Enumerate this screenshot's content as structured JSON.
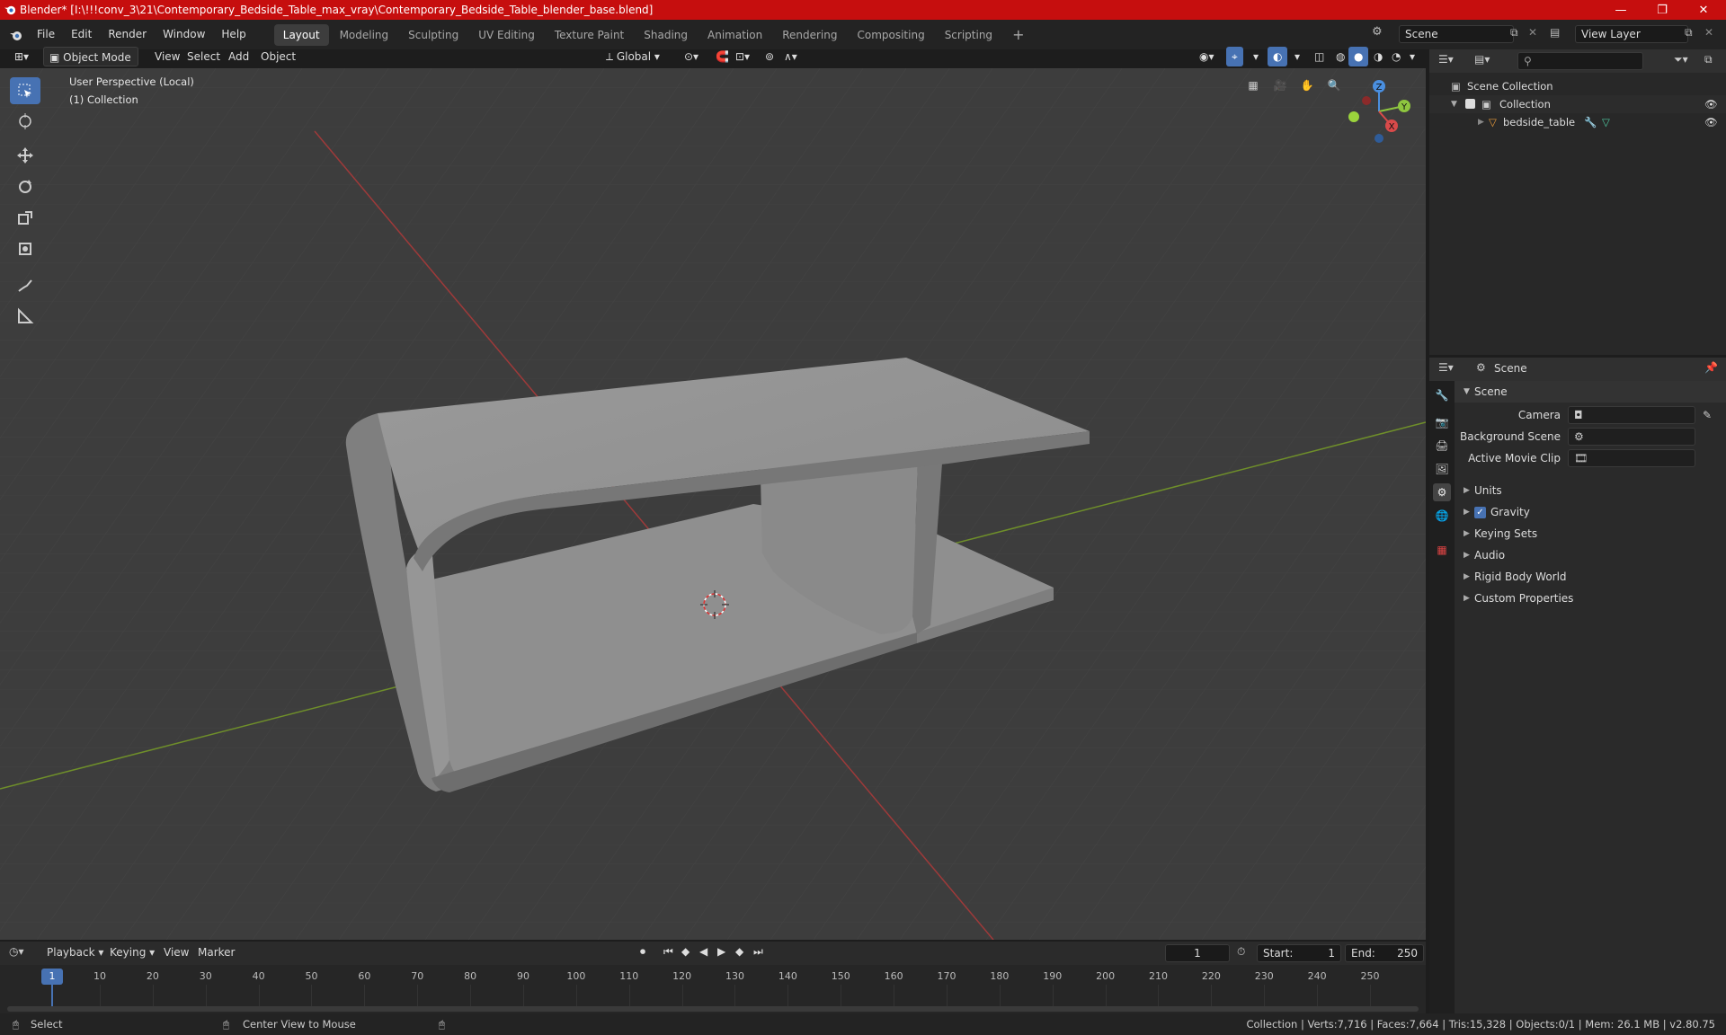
{
  "window": {
    "title": "Blender* [I:\\!!!conv_3\\21\\Contemporary_Bedside_Table_max_vray\\Contemporary_Bedside_Table_blender_base.blend]",
    "minimize": "—",
    "maximize": "❐",
    "close": "✕"
  },
  "menu": [
    "File",
    "Edit",
    "Render",
    "Window",
    "Help"
  ],
  "workspaces": [
    "Layout",
    "Modeling",
    "Sculpting",
    "UV Editing",
    "Texture Paint",
    "Shading",
    "Animation",
    "Rendering",
    "Compositing",
    "Scripting"
  ],
  "scene_field": "Scene",
  "view_layer_field": "View Layer",
  "viewport_header": {
    "mode": "Object Mode",
    "menus": [
      "View",
      "Select",
      "Add",
      "Object"
    ],
    "transform_orientation": "Global"
  },
  "viewport": {
    "perspective_label": "User Perspective (Local)",
    "collection_label": "(1) Collection",
    "gizmo_axes": {
      "z": "Z",
      "y": "Y",
      "x": "X"
    }
  },
  "outliner": {
    "root": "Scene Collection",
    "collection": "Collection",
    "object": "bedside_table"
  },
  "properties": {
    "header": "Scene",
    "panel_title": "Scene",
    "fields": [
      {
        "label": "Camera"
      },
      {
        "label": "Background Scene"
      },
      {
        "label": "Active Movie Clip"
      }
    ],
    "subpanels": [
      "Units",
      "Gravity",
      "Keying Sets",
      "Audio",
      "Rigid Body World",
      "Custom Properties"
    ]
  },
  "timeline": {
    "menus": [
      "Playback",
      "Keying",
      "View",
      "Marker"
    ],
    "current_frame": "1",
    "start_label": "Start:",
    "start": "1",
    "end_label": "End:",
    "end": "250",
    "ticks": [
      "1",
      "10",
      "20",
      "30",
      "40",
      "50",
      "60",
      "70",
      "80",
      "90",
      "100",
      "110",
      "120",
      "130",
      "140",
      "150",
      "160",
      "170",
      "180",
      "190",
      "200",
      "210",
      "220",
      "230",
      "240",
      "250"
    ]
  },
  "statusbar": {
    "left_action": "Select",
    "middle_action": "Center View to Mouse",
    "stats": "Collection | Verts:7,716 | Faces:7,664 | Tris:15,328 | Objects:0/1 | Mem: 26.1 MB | v2.80.75"
  },
  "colors": {
    "titlebar": "#c60e0e",
    "accent": "#4772b3",
    "x_axis": "#d94a4a",
    "y_axis": "#8ec63f",
    "z_axis": "#4a8fe0"
  }
}
